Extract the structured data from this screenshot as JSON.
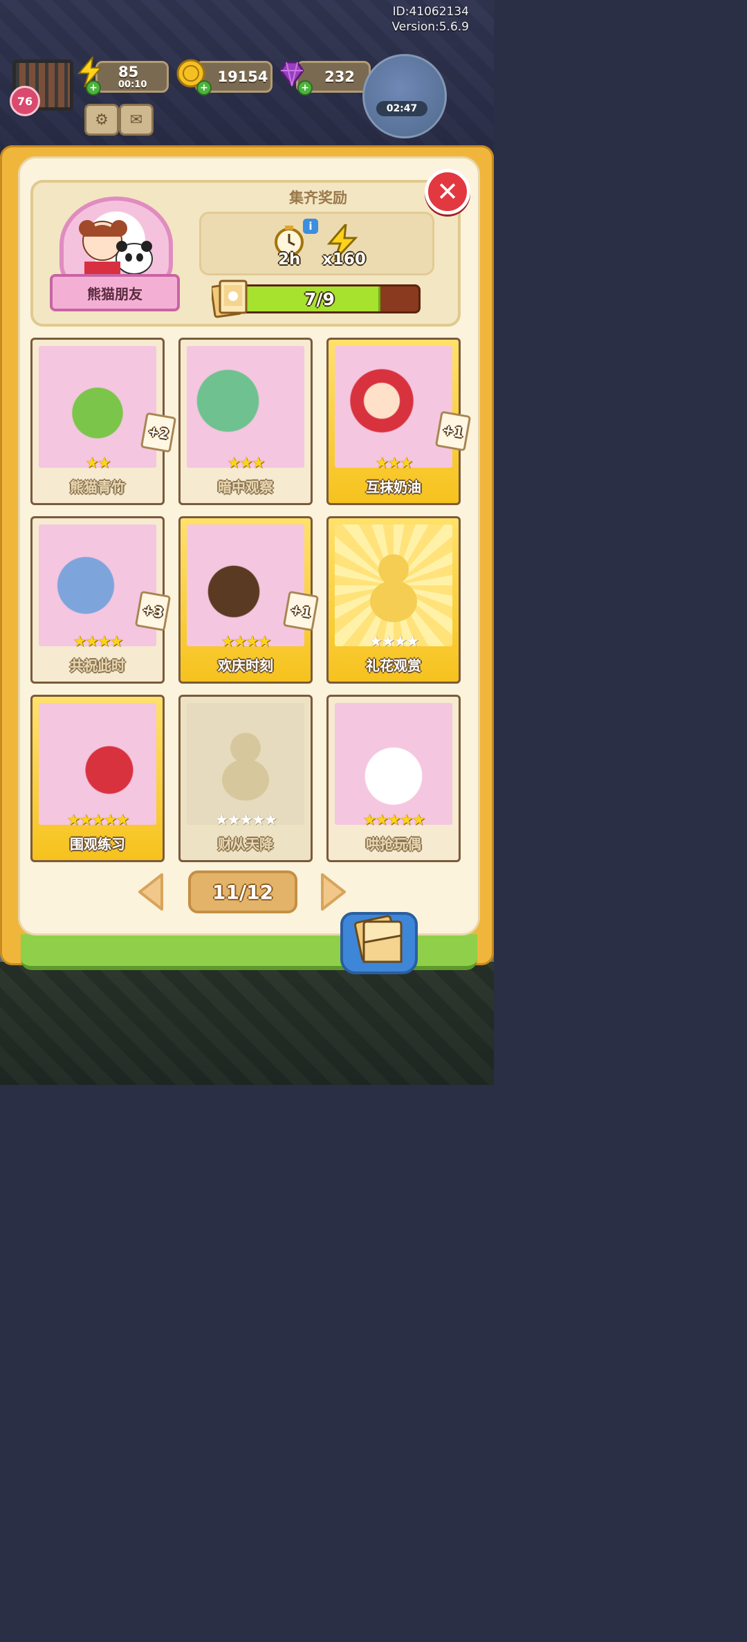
{
  "header_info": {
    "player_id": "ID:41062134",
    "version": "Version:5.6.9"
  },
  "hud": {
    "level": "76",
    "energy": {
      "value": "85",
      "timer": "00:10",
      "icon": "lightning-icon"
    },
    "coins": {
      "value": "19154",
      "icon": "coin-icon"
    },
    "gems": {
      "value": "232",
      "icon": "gem-icon"
    },
    "settings_icon": "gear-icon",
    "mail_icon": "mail-icon",
    "event_timer": "02:47"
  },
  "album": {
    "name": "熊猫朋友",
    "reward_title": "集齐奖励",
    "rewards": [
      {
        "icon": "clock-icon",
        "label": "2h"
      },
      {
        "icon": "lightning-icon",
        "label": "x160"
      }
    ],
    "progress_text": "7/9",
    "progress_fraction": 0.778
  },
  "cards": [
    {
      "name": "熊猫青竹",
      "stars": 2,
      "max": 2,
      "style": "normal",
      "dup": "+2"
    },
    {
      "name": "暗中观察",
      "stars": 3,
      "max": 3,
      "style": "normal",
      "dup": ""
    },
    {
      "name": "互抹奶油",
      "stars": 3,
      "max": 3,
      "style": "gold",
      "dup": "+1"
    },
    {
      "name": "共祝此时",
      "stars": 4,
      "max": 4,
      "style": "normal",
      "dup": "+3"
    },
    {
      "name": "欢庆时刻",
      "stars": 4,
      "max": 4,
      "style": "gold",
      "dup": "+1"
    },
    {
      "name": "礼花观赏",
      "stars": 0,
      "max": 4,
      "style": "gold-empty",
      "dup": ""
    },
    {
      "name": "围观练习",
      "stars": 5,
      "max": 5,
      "style": "gold",
      "dup": ""
    },
    {
      "name": "财从天降",
      "stars": 0,
      "max": 5,
      "style": "empty",
      "dup": ""
    },
    {
      "name": "哄抢玩偶",
      "stars": 5,
      "max": 5,
      "style": "normal",
      "dup": ""
    }
  ],
  "pagination": {
    "page": "11/12",
    "prev_icon": "arrow-left-icon",
    "next_icon": "arrow-right-icon"
  },
  "close_icon": "close-icon",
  "album_button_icon": "album-icon",
  "colors": {
    "frame": "#f0b63c",
    "panel": "#fbf3dc",
    "close": "#e2383f",
    "progress": "#a7e22e",
    "gold_card": "#f6c21e"
  }
}
